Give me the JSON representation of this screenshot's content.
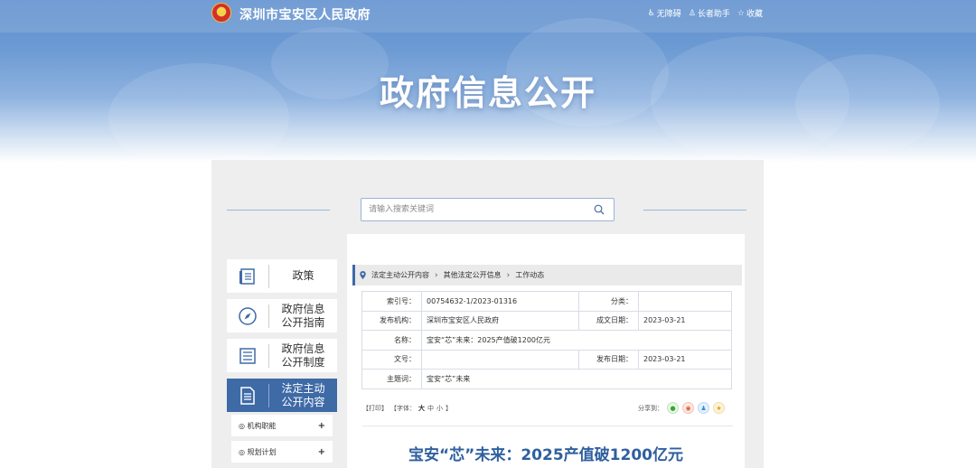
{
  "header": {
    "site_name": "深圳市宝安区人民政府",
    "links": [
      {
        "label": "无障碍",
        "icon": "accessibility-icon"
      },
      {
        "label": "长者助手",
        "icon": "elder-assistant-icon"
      },
      {
        "label": "收藏",
        "icon": "star-icon"
      }
    ],
    "banner_title": "政府信息公开"
  },
  "search": {
    "placeholder": "请输入搜索关键词"
  },
  "sidebar": {
    "items": [
      {
        "label": "政策",
        "icon": "book-icon"
      },
      {
        "label": "政府信息公开指南",
        "icon": "compass-icon"
      },
      {
        "label": "政府信息公开制度",
        "icon": "list-icon"
      },
      {
        "label": "法定主动公开内容",
        "icon": "document-icon",
        "active": true
      }
    ],
    "subitems": [
      {
        "label": "机构职能"
      },
      {
        "label": "规划计划"
      }
    ]
  },
  "breadcrumb": {
    "items": [
      "法定主动公开内容",
      "其他法定公开信息",
      "工作动态"
    ]
  },
  "meta": {
    "index_no_label": "索引号：",
    "index_no": "00754632-1/2023-01316",
    "category_label": "分类：",
    "category": "",
    "publisher_label": "发布机构：",
    "publisher": "深圳市宝安区人民政府",
    "created_label": "成文日期：",
    "created": "2023-03-21",
    "name_label": "名称：",
    "name": "宝安“芯”未来：2025产值破1200亿元",
    "doc_no_label": "文号：",
    "doc_no": "",
    "published_label": "发布日期：",
    "published": "2023-03-21",
    "subject_label": "主题词：",
    "subject": "宝安“芯”未来"
  },
  "tools": {
    "print": "【打印】",
    "font_prefix": "【字体：",
    "font_large": "大",
    "font_medium": "中",
    "font_small": "小",
    "font_suffix": "】",
    "share_label": "分享到："
  },
  "article": {
    "title": "宝安“芯”未来：2025产值破1200亿元"
  },
  "colors": {
    "accent": "#3e6aa6",
    "title_blue": "#2f5f9e"
  }
}
